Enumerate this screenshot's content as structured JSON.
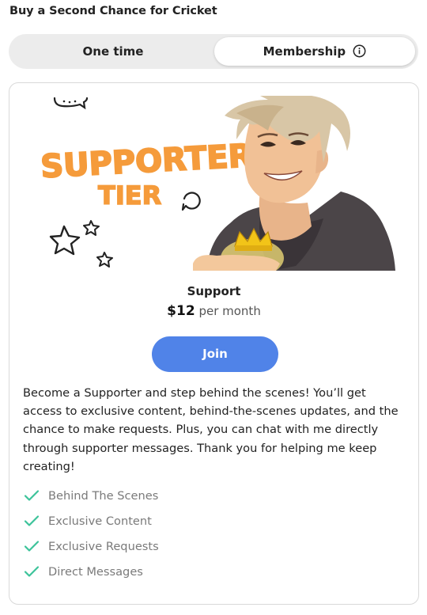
{
  "page": {
    "title": "Buy a Second Chance for Cricket"
  },
  "toggle": {
    "options": [
      "One time",
      "Membership"
    ],
    "selected": "Membership"
  },
  "tier": {
    "banner": {
      "text_line1": "SUPPORTER",
      "text_line2": "TIER"
    },
    "name": "Support",
    "price": "$12",
    "period": "per month",
    "button_label": "Join",
    "description": "Become a Supporter and step behind the scenes! You’ll get access to exclusive content, behind-the-scenes updates, and the chance to make requests. Plus, you can chat with me directly through supporter messages. Thank you for helping me keep creating!",
    "features": [
      "Behind The Scenes",
      "Exclusive Content",
      "Exclusive Requests",
      "Direct Messages"
    ]
  },
  "colors": {
    "accent": "#5083e8",
    "check": "#3cc39a",
    "banner_text": "#f59b3b",
    "crown": "#f2c418"
  }
}
